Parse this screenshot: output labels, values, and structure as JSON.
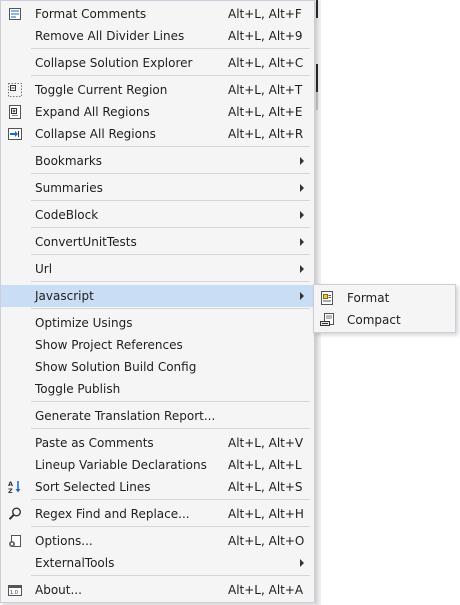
{
  "menu": {
    "items": [
      {
        "label": "Format Comments",
        "shortcut": "Alt+L, Alt+F",
        "icon": "format-comments-icon"
      },
      {
        "label": "Remove All Divider Lines",
        "shortcut": "Alt+L, Alt+9"
      },
      {
        "label": "Collapse Solution Explorer",
        "shortcut": "Alt+L, Alt+C"
      },
      {
        "label": "Toggle Current Region",
        "shortcut": "Alt+L, Alt+T",
        "icon": "toggle-region-icon"
      },
      {
        "label": "Expand All Regions",
        "shortcut": "Alt+L, Alt+E",
        "icon": "expand-regions-icon"
      },
      {
        "label": "Collapse All Regions",
        "shortcut": "Alt+L, Alt+R",
        "icon": "collapse-regions-icon"
      },
      {
        "label": "Bookmarks",
        "submenu": true
      },
      {
        "label": "Summaries",
        "submenu": true
      },
      {
        "label": "CodeBlock",
        "submenu": true
      },
      {
        "label": "ConvertUnitTests",
        "submenu": true
      },
      {
        "label": "Url",
        "submenu": true
      },
      {
        "label": "Javascript",
        "submenu": true,
        "highlighted": true
      },
      {
        "label": "Optimize Usings"
      },
      {
        "label": "Show Project References"
      },
      {
        "label": "Show Solution Build Config"
      },
      {
        "label": "Toggle Publish"
      },
      {
        "label": "Generate Translation Report..."
      },
      {
        "label": "Paste as Comments",
        "shortcut": "Alt+L, Alt+V"
      },
      {
        "label": "Lineup Variable Declarations",
        "shortcut": "Alt+L, Alt+L"
      },
      {
        "label": "Sort Selected Lines",
        "shortcut": "Alt+L, Alt+S",
        "icon": "sort-az-icon"
      },
      {
        "label": "Regex Find and Replace...",
        "shortcut": "Alt+L, Alt+H",
        "icon": "search-icon"
      },
      {
        "label": "Options...",
        "shortcut": "Alt+L, Alt+O",
        "icon": "options-icon"
      },
      {
        "label": "ExternalTools",
        "submenu": true
      },
      {
        "label": "About...",
        "shortcut": "Alt+L, Alt+A",
        "icon": "about-icon"
      }
    ]
  },
  "submenu": {
    "items": [
      {
        "label": "Format",
        "icon": "format-icon"
      },
      {
        "label": "Compact",
        "icon": "compact-icon"
      }
    ]
  }
}
